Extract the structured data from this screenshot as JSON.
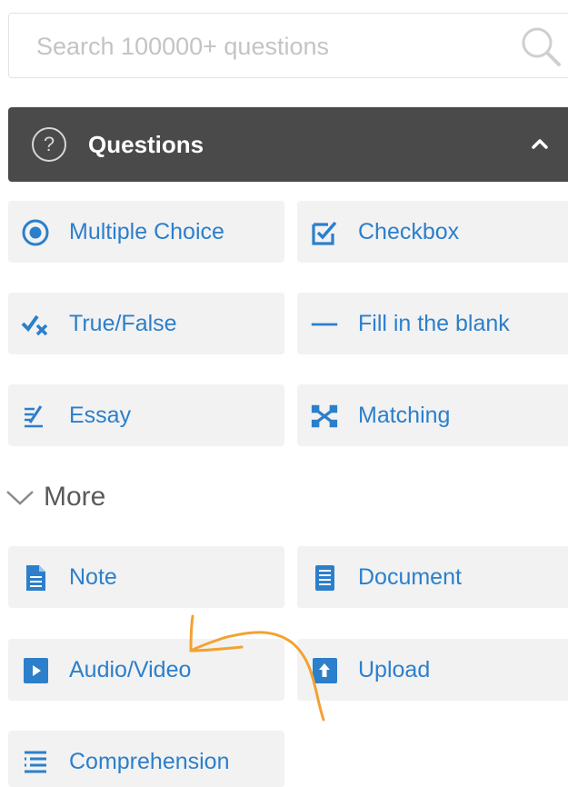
{
  "search": {
    "placeholder": "Search 100000+ questions",
    "icon": "search-icon"
  },
  "header": {
    "title": "Questions",
    "help_icon_text": "?",
    "icon": "chevron-up-icon",
    "background": "#4a4a4a"
  },
  "question_types": [
    {
      "label": "Multiple Choice",
      "icon": "radio-icon"
    },
    {
      "label": "Checkbox",
      "icon": "checkbox-icon"
    },
    {
      "label": "True/False",
      "icon": "true-false-icon"
    },
    {
      "label": "Fill in the blank",
      "icon": "blank-line-icon"
    },
    {
      "label": "Essay",
      "icon": "essay-icon"
    },
    {
      "label": "Matching",
      "icon": "matching-icon"
    }
  ],
  "more": {
    "label": "More",
    "icon": "chevron-down-icon"
  },
  "more_types": [
    {
      "label": "Note",
      "icon": "note-icon"
    },
    {
      "label": "Document",
      "icon": "document-icon"
    },
    {
      "label": "Audio/Video",
      "icon": "play-icon"
    },
    {
      "label": "Upload",
      "icon": "upload-icon"
    },
    {
      "label": "Comprehension",
      "icon": "list-icon"
    }
  ],
  "colors": {
    "accent": "#2c7fcb",
    "tile_bg": "#f2f2f2",
    "annotation": "#f3a230"
  }
}
